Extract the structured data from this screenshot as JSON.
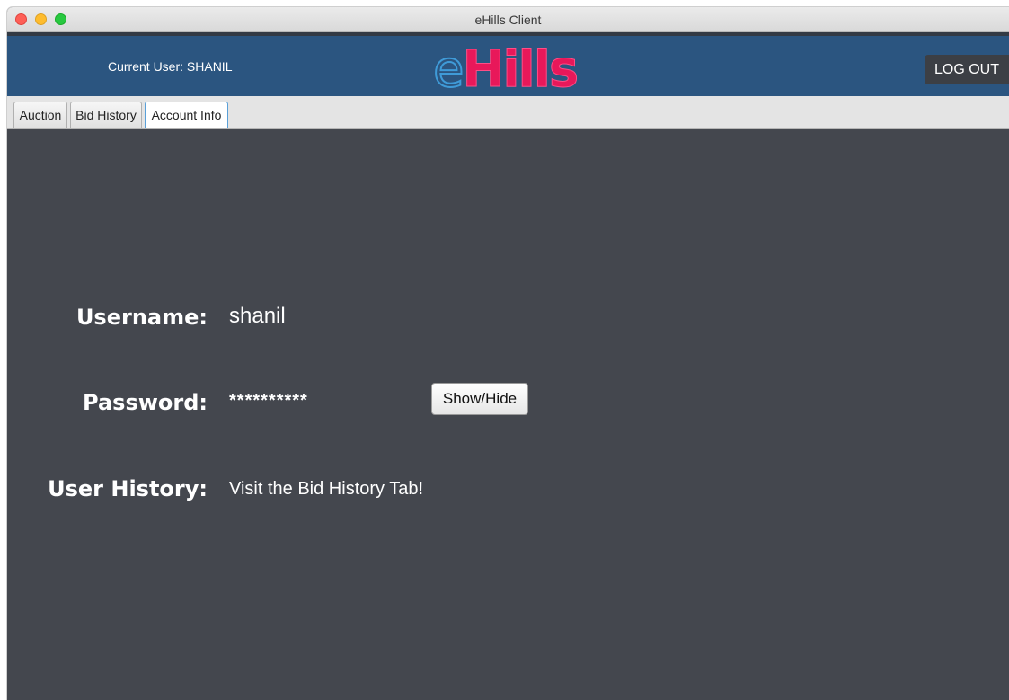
{
  "window": {
    "title": "eHills Client"
  },
  "header": {
    "current_user_label": "Current User: SHANIL",
    "logo_e": "e",
    "logo_hills": "Hills",
    "logout_label": "LOG OUT"
  },
  "tabs": [
    {
      "label": "Auction"
    },
    {
      "label": "Bid History"
    },
    {
      "label": "Account Info",
      "selected": true
    }
  ],
  "account": {
    "username_label": "Username:",
    "username_value": "shanil",
    "password_label": "Password:",
    "password_value": "**********",
    "show_hide_label": "Show/Hide",
    "history_label": "User History:",
    "history_value": "Visit the Bid History Tab!"
  },
  "colors": {
    "header_bg": "#2b5580",
    "content_bg": "#44474e",
    "logo_e": "#3f9bd8",
    "logo_hills": "#e8185a"
  }
}
